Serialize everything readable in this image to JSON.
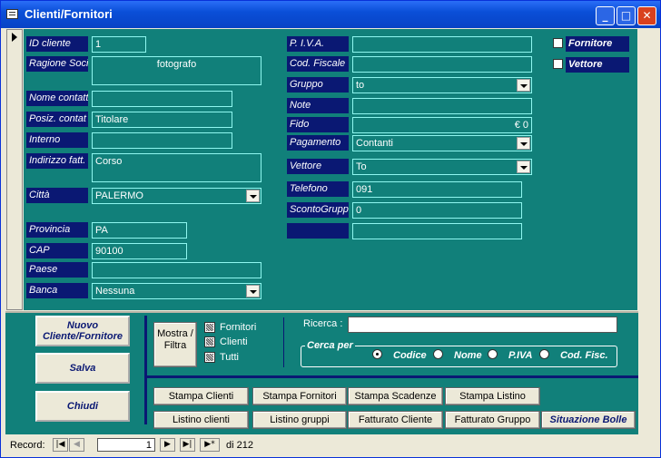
{
  "window": {
    "title": "Clienti/Fornitori",
    "min": "_",
    "max": "□",
    "close": "✕"
  },
  "left": {
    "id_cliente": {
      "label": "ID cliente",
      "value": "1"
    },
    "ragione": {
      "label": "Ragione Soci",
      "value": "fotografo"
    },
    "nome_contatto": {
      "label": "Nome contatt",
      "value": ""
    },
    "posiz": {
      "label": "Posiz. contat",
      "value": "Titolare"
    },
    "interno": {
      "label": "Interno",
      "value": ""
    },
    "indirizzo": {
      "label": "Indirizzo fatt.",
      "value": "Corso"
    },
    "citta": {
      "label": "Città",
      "value": "PALERMO"
    },
    "provincia": {
      "label": "Provincia",
      "value": "PA"
    },
    "cap": {
      "label": "CAP",
      "value": "90100"
    },
    "paese": {
      "label": "Paese",
      "value": ""
    },
    "banca": {
      "label": "Banca",
      "value": "Nessuna"
    }
  },
  "mid": {
    "piva": {
      "label": "P. I.V.A.",
      "value": ""
    },
    "codfisc": {
      "label": "Cod. Fiscale",
      "value": ""
    },
    "gruppo": {
      "label": "Gruppo",
      "value": "to"
    },
    "note": {
      "label": "Note",
      "value": ""
    },
    "fido": {
      "label": "Fido",
      "value": "€ 0"
    },
    "pagamento": {
      "label": "Pagamento",
      "value": "Contanti"
    },
    "vettore": {
      "label": "Vettore",
      "value": "To"
    },
    "telefono": {
      "label": "Telefono",
      "value": "091"
    },
    "sconto": {
      "label": "ScontoGrupp",
      "value": "0"
    },
    "blank": {
      "label": "",
      "value": ""
    }
  },
  "right": {
    "fornitore": "Fornitore",
    "vettore": "Vettore"
  },
  "footer": {
    "nuovo": "Nuovo Cliente/Fornitore",
    "salva": "Salva",
    "chiudi": "Chiudi",
    "mostra": "Mostra / Filtra",
    "filters": [
      "Fornitori",
      "Clienti",
      "Tutti"
    ],
    "ricerca_label": "Ricerca :",
    "ricerca_value": "",
    "cerca_per": "Cerca per",
    "radios": [
      "Codice",
      "Nome",
      "P.IVA",
      "Cod. Fisc."
    ],
    "buttons_row1": [
      "Stampa Clienti",
      "Stampa Fornitori",
      "Stampa Scadenze",
      "Stampa Listino"
    ],
    "buttons_row2": [
      "Listino clienti",
      "Listino gruppi",
      "Fatturato Cliente",
      "Fatturato Gruppo",
      "Situazione Bolle"
    ]
  },
  "nav": {
    "label": "Record:",
    "current": "1",
    "total": "di 212",
    "first": "|◀",
    "prev": "◀",
    "next": "▶",
    "last": "▶|",
    "new": "▶*"
  }
}
